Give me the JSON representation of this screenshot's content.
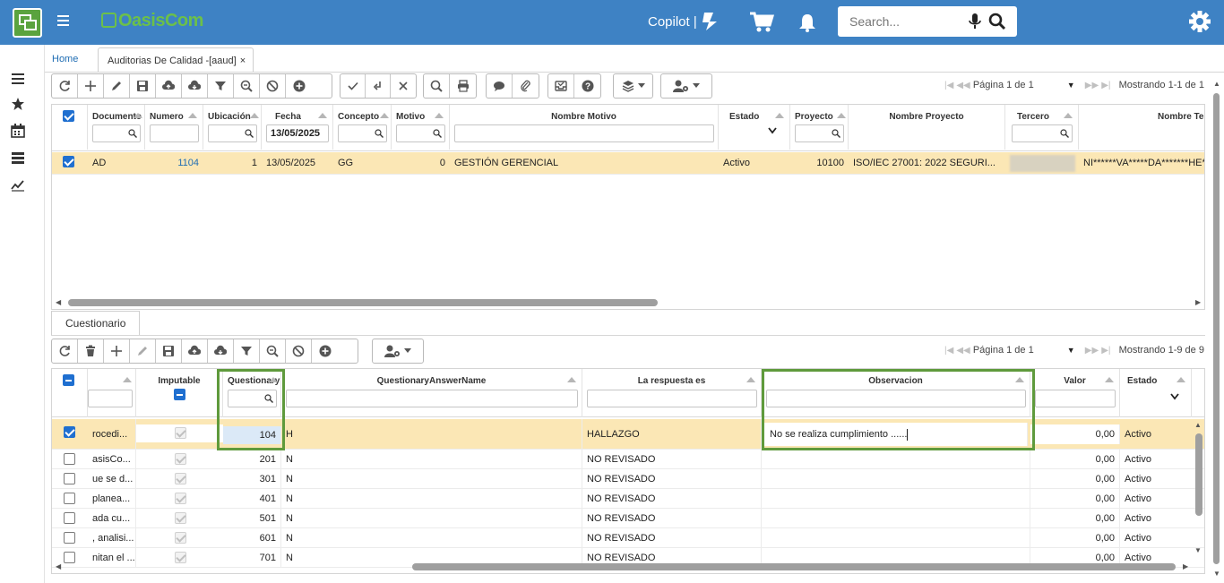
{
  "header": {
    "brand": "OasisCom",
    "copilot_label": "Copilot |",
    "search_placeholder": "Search..."
  },
  "tabs": {
    "home": "Home",
    "active": "Auditorias De Calidad -[aaud]",
    "close": "×"
  },
  "main_pager": {
    "page": "Página 1 de 1",
    "showing": "Mostrando 1-1 de 1"
  },
  "main_grid": {
    "columns": [
      "Documento",
      "Numero",
      "Ubicación",
      "Fecha",
      "Concepto",
      "Motivo",
      "Nombre Motivo",
      "Estado",
      "Proyecto",
      "Nombre Proyecto",
      "Tercero",
      "Nombre Tercero"
    ],
    "fecha_filter": "13/05/2025",
    "row": {
      "documento": "AD",
      "numero": "1104",
      "ubicacion": "1",
      "fecha": "13/05/2025",
      "concepto": "GG",
      "motivo": "0",
      "nombre_motivo": "GESTIÓN GERENCIAL",
      "estado": "Activo",
      "proyecto": "10100",
      "nombre_proyecto": "ISO/IEC 27001: 2022 SEGURI...",
      "nombre_tercero": "NI******VA*****DA*******HE*"
    }
  },
  "subtab": "Cuestionario",
  "sub_pager": {
    "page": "Página 1 de 1",
    "showing": "Mostrando 1-9 de 9"
  },
  "sub_grid": {
    "columns": [
      "Imputable",
      "Questionary",
      "QuestionaryAnswerName",
      "La respuesta es",
      "Observacion",
      "Valor",
      "Estado"
    ],
    "rows": [
      {
        "desc": "rocedi...",
        "q": "104",
        "ans": "H",
        "resp": "HALLAZGO",
        "obs": "No se realiza cumplimiento ......",
        "valor": "0,00",
        "estado": "Activo",
        "checked": true
      },
      {
        "desc": "asisCo...",
        "q": "201",
        "ans": "N",
        "resp": "NO REVISADO",
        "obs": "",
        "valor": "0,00",
        "estado": "Activo",
        "checked": false
      },
      {
        "desc": "ue se d...",
        "q": "301",
        "ans": "N",
        "resp": "NO REVISADO",
        "obs": "",
        "valor": "0,00",
        "estado": "Activo",
        "checked": false
      },
      {
        "desc": "planea...",
        "q": "401",
        "ans": "N",
        "resp": "NO REVISADO",
        "obs": "",
        "valor": "0,00",
        "estado": "Activo",
        "checked": false
      },
      {
        "desc": "ada cu...",
        "q": "501",
        "ans": "N",
        "resp": "NO REVISADO",
        "obs": "",
        "valor": "0,00",
        "estado": "Activo",
        "checked": false
      },
      {
        "desc": ", analisi...",
        "q": "601",
        "ans": "N",
        "resp": "NO REVISADO",
        "obs": "",
        "valor": "0,00",
        "estado": "Activo",
        "checked": false
      },
      {
        "desc": "nitan el ...",
        "q": "701",
        "ans": "N",
        "resp": "NO REVISADO",
        "obs": "",
        "valor": "0,00",
        "estado": "Activo",
        "checked": false
      }
    ]
  },
  "colors": {
    "topbar": "#3e82c4",
    "selected_row": "#fbe7b5",
    "highlight_box": "#5f9a3c"
  }
}
